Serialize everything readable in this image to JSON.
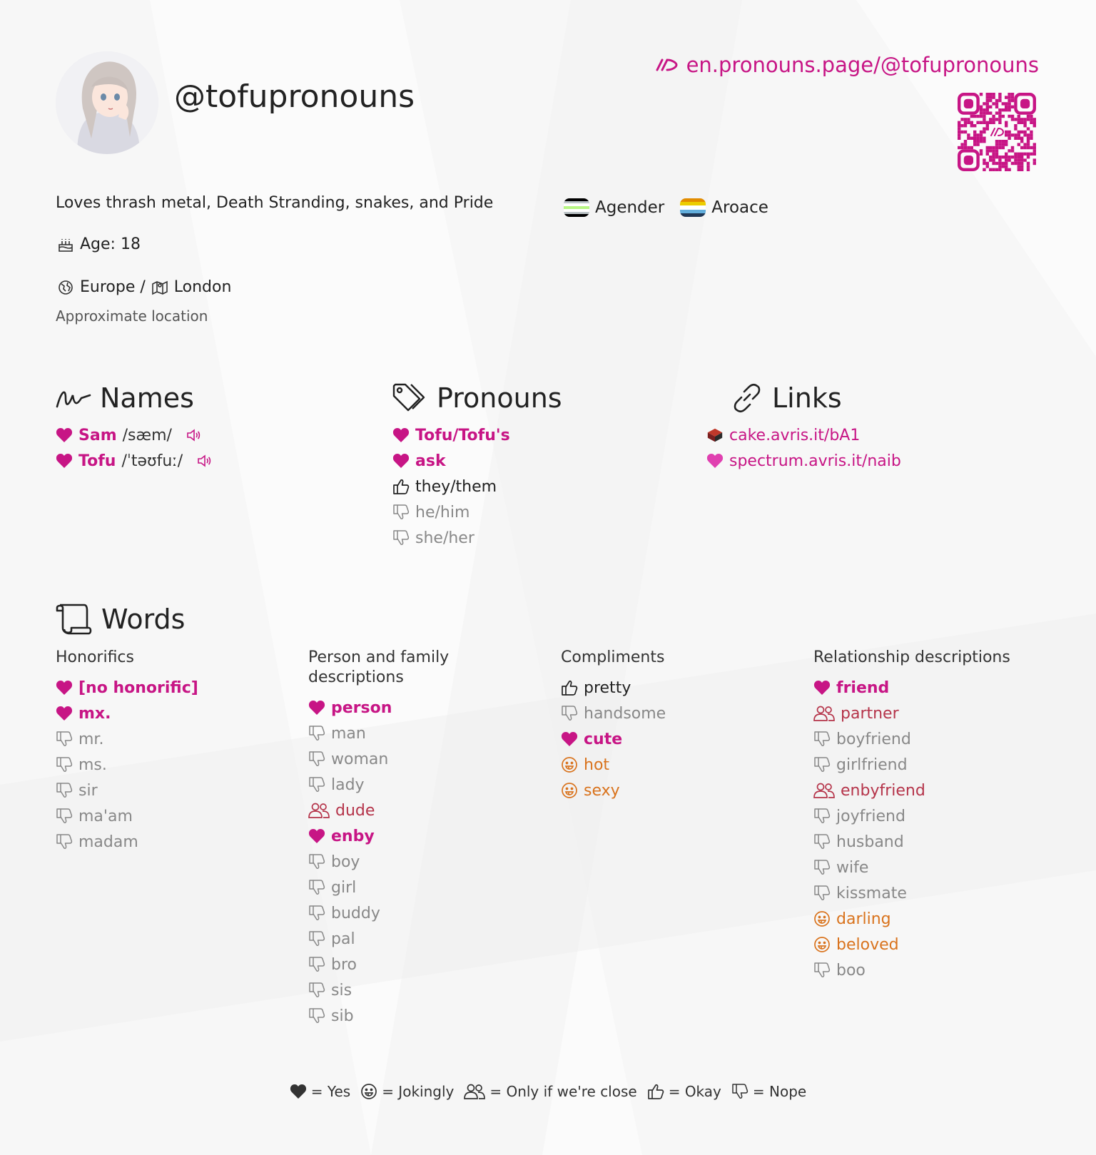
{
  "profile": {
    "username": "@tofupronouns",
    "url": "en.pronouns.page/@tofupronouns",
    "bio": "Loves thrash metal, Death Stranding, snakes, and Pride",
    "age": "Age: 18",
    "region": "Europe /",
    "city": "London",
    "location_note": "Approximate location",
    "flags": [
      {
        "label": "Agender",
        "stripes": [
          "#000000",
          "#bcc4c7",
          "#ffffff",
          "#b7f684",
          "#ffffff",
          "#bcc4c7",
          "#000000"
        ]
      },
      {
        "label": "Aroace",
        "stripes": [
          "#e28c00",
          "#eccd00",
          "#ffffff",
          "#62aedc",
          "#203856"
        ]
      }
    ]
  },
  "colors": {
    "accent": "#c71585",
    "jokingly": "#d9731d",
    "close": "#b5344a",
    "nope": "#888888"
  },
  "names": {
    "title": "Names",
    "items": [
      {
        "name": "Sam",
        "ipa": "/sæm/",
        "opinion": "yes"
      },
      {
        "name": "Tofu",
        "ipa": "/ˈtəʊfuː/",
        "opinion": "yes"
      }
    ]
  },
  "pronouns": {
    "title": "Pronouns",
    "items": [
      {
        "label": "Tofu/Tofu's",
        "opinion": "yes"
      },
      {
        "label": "ask",
        "opinion": "yes"
      },
      {
        "label": "they/them",
        "opinion": "okay"
      },
      {
        "label": "he/him",
        "opinion": "nope"
      },
      {
        "label": "she/her",
        "opinion": "nope"
      }
    ]
  },
  "links": {
    "title": "Links",
    "items": [
      {
        "label": "cake.avris.it/bA1",
        "icon": "cake-icon"
      },
      {
        "label": "spectrum.avris.it/naib",
        "icon": "heart-icon"
      }
    ]
  },
  "words": {
    "title": "Words",
    "columns": [
      {
        "header": "Honorifics",
        "items": [
          {
            "label": "[no honorific]",
            "opinion": "yes"
          },
          {
            "label": "mx.",
            "opinion": "yes"
          },
          {
            "label": "mr.",
            "opinion": "nope"
          },
          {
            "label": "ms.",
            "opinion": "nope"
          },
          {
            "label": "sir",
            "opinion": "nope"
          },
          {
            "label": "ma'am",
            "opinion": "nope"
          },
          {
            "label": "madam",
            "opinion": "nope"
          }
        ]
      },
      {
        "header": "Person and family descriptions",
        "items": [
          {
            "label": "person",
            "opinion": "yes"
          },
          {
            "label": "man",
            "opinion": "nope"
          },
          {
            "label": "woman",
            "opinion": "nope"
          },
          {
            "label": "lady",
            "opinion": "nope"
          },
          {
            "label": "dude",
            "opinion": "close"
          },
          {
            "label": "enby",
            "opinion": "yes"
          },
          {
            "label": "boy",
            "opinion": "nope"
          },
          {
            "label": "girl",
            "opinion": "nope"
          },
          {
            "label": "buddy",
            "opinion": "nope"
          },
          {
            "label": "pal",
            "opinion": "nope"
          },
          {
            "label": "bro",
            "opinion": "nope"
          },
          {
            "label": "sis",
            "opinion": "nope"
          },
          {
            "label": "sib",
            "opinion": "nope"
          }
        ]
      },
      {
        "header": "Compliments",
        "items": [
          {
            "label": "pretty",
            "opinion": "okay"
          },
          {
            "label": "handsome",
            "opinion": "nope"
          },
          {
            "label": "cute",
            "opinion": "yes"
          },
          {
            "label": "hot",
            "opinion": "jokingly"
          },
          {
            "label": "sexy",
            "opinion": "jokingly"
          }
        ]
      },
      {
        "header": "Relationship descriptions",
        "items": [
          {
            "label": "friend",
            "opinion": "yes"
          },
          {
            "label": "partner",
            "opinion": "close"
          },
          {
            "label": "boyfriend",
            "opinion": "nope"
          },
          {
            "label": "girlfriend",
            "opinion": "nope"
          },
          {
            "label": "enbyfriend",
            "opinion": "close"
          },
          {
            "label": "joyfriend",
            "opinion": "nope"
          },
          {
            "label": "husband",
            "opinion": "nope"
          },
          {
            "label": "wife",
            "opinion": "nope"
          },
          {
            "label": "kissmate",
            "opinion": "nope"
          },
          {
            "label": "darling",
            "opinion": "jokingly"
          },
          {
            "label": "beloved",
            "opinion": "jokingly"
          },
          {
            "label": "boo",
            "opinion": "nope"
          }
        ]
      }
    ]
  },
  "legend": [
    {
      "opinion": "yes",
      "label": "= Yes"
    },
    {
      "opinion": "jokingly",
      "label": "= Jokingly"
    },
    {
      "opinion": "close",
      "label": "= Only if we're close"
    },
    {
      "opinion": "okay",
      "label": "= Okay"
    },
    {
      "opinion": "nope",
      "label": "= Nope"
    }
  ]
}
